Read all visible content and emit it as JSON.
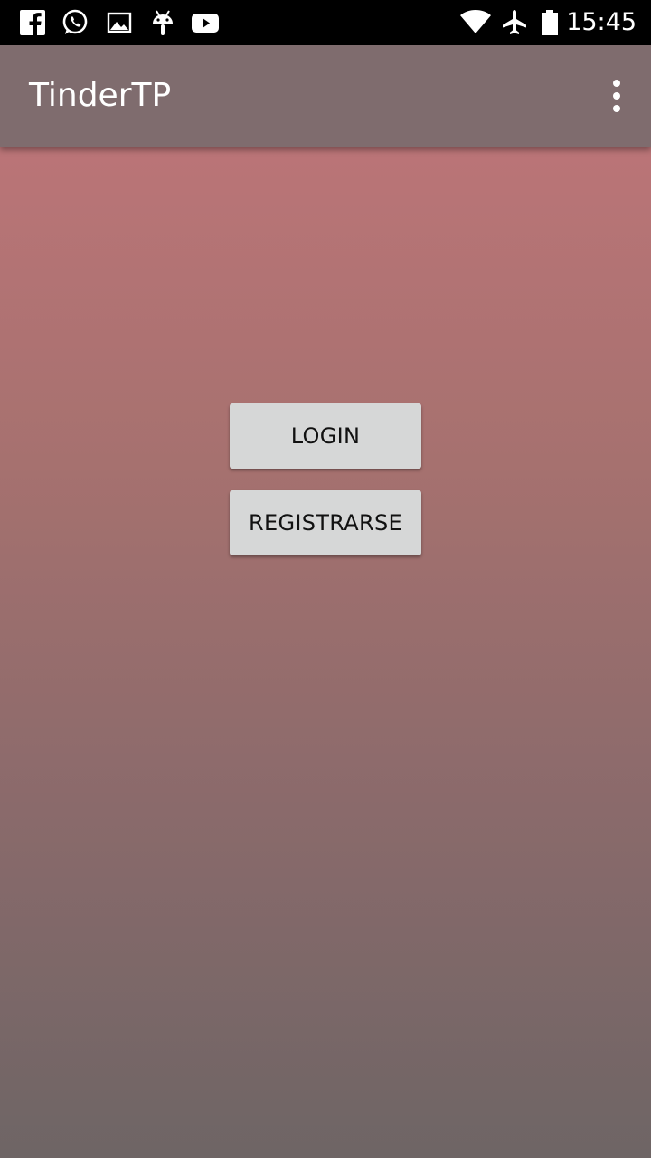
{
  "status_bar": {
    "time": "15:45",
    "left_icons": [
      "facebook-icon",
      "whatsapp-icon",
      "gallery-icon",
      "android-icon",
      "youtube-icon"
    ],
    "right_icons": [
      "wifi-icon",
      "airplane-mode-icon",
      "battery-icon"
    ]
  },
  "app_bar": {
    "title": "TinderTP",
    "menu_icon": "more-vert-icon"
  },
  "main": {
    "login_label": "LOGIN",
    "register_label": "REGISTRARSE"
  },
  "colors": {
    "app_bar": "#7f6c6e",
    "background_top": "#c4767b",
    "background_bottom": "#6e6565",
    "button": "#d6d7d7"
  }
}
